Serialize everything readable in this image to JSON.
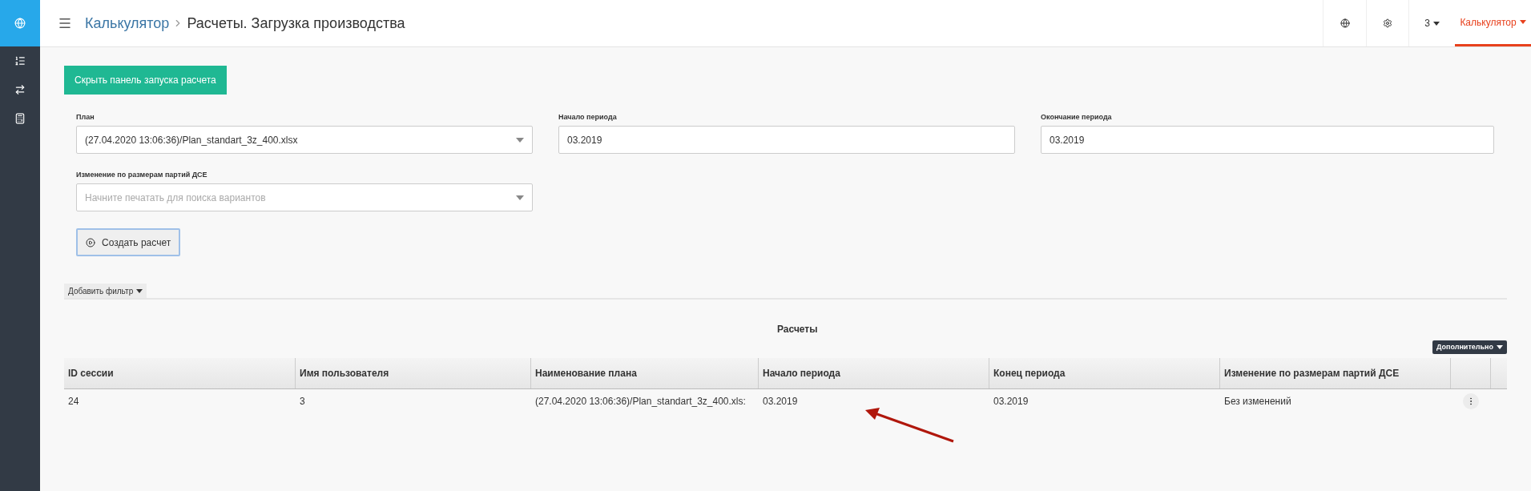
{
  "sidebar": {
    "items": [
      {
        "selected": true
      },
      {
        "selected": false
      },
      {
        "selected": false
      },
      {
        "selected": false
      }
    ]
  },
  "breadcrumb": {
    "parent": "Калькулятор",
    "current": "Расчеты. Загрузка производства"
  },
  "topbar": {
    "user": "3",
    "module": {
      "label": "Калькулятор",
      "selected": true
    }
  },
  "toggle_button": "Скрыть панель запуска расчета",
  "form": {
    "plan": {
      "label": "План",
      "value": "(27.04.2020 13:06:36)/Plan_standart_3z_400.xlsx"
    },
    "start": {
      "label": "Начало периода",
      "value": "03.2019"
    },
    "end": {
      "label": "Окончание периода",
      "value": "03.2019"
    },
    "change": {
      "label": "Изменение по размерам партий ДСЕ",
      "placeholder": "Начните печатать для поиска вариантов"
    },
    "create_button": "Создать расчет"
  },
  "filter_button": "Добавить фильтр",
  "table": {
    "title": "Расчеты",
    "more_button": "Дополнительно",
    "columns": [
      "ID сессии",
      "Имя пользователя",
      "Наименование плана",
      "Начало периода",
      "Конец периода",
      "Изменение по размерам партий ДСЕ"
    ],
    "rows": [
      [
        "24",
        "3",
        "(27.04.2020 13:06:36)/Plan_standart_3z_400.xls:",
        "03.2019",
        "03.2019",
        "Без изменений"
      ]
    ]
  }
}
